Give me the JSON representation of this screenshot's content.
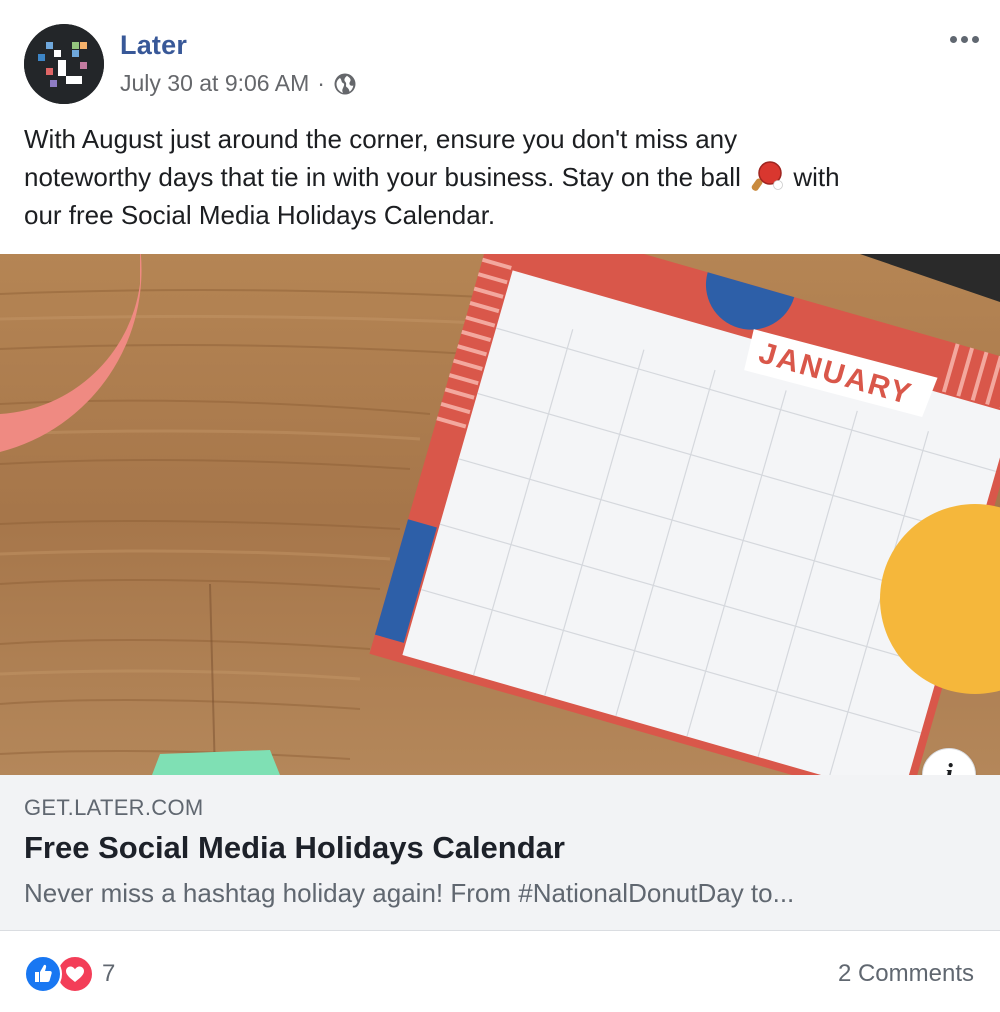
{
  "post": {
    "page_name": "Later",
    "timestamp": "July 30 at 9:06 AM",
    "separator": "·",
    "privacy_icon": "globe-icon",
    "more_icon": "more-options-icon",
    "text_line_1": "With August just around the corner, ensure you don't miss any",
    "text_line_2a": "noteworthy days that tie in with your business. Stay on the ball",
    "text_line_2b": "with",
    "text_line_3": "our free Social Media Holidays Calendar.",
    "emoji_icon": "ping-pong-paddle-icon"
  },
  "image": {
    "calendar_month": "JANUARY",
    "info_label": "i"
  },
  "link": {
    "domain": "GET.LATER.COM",
    "title": "Free Social Media Holidays Calendar",
    "description": "Never miss a hashtag holiday again! From #NationalDonutDay to..."
  },
  "footer": {
    "reaction_icons": [
      "like-icon",
      "love-icon"
    ],
    "reaction_count": "7",
    "comments": "2 Comments"
  },
  "colors": {
    "name_blue": "#385898",
    "like_blue": "#1877f2",
    "love_red": "#f33e58",
    "link_bg": "#f2f3f5"
  }
}
